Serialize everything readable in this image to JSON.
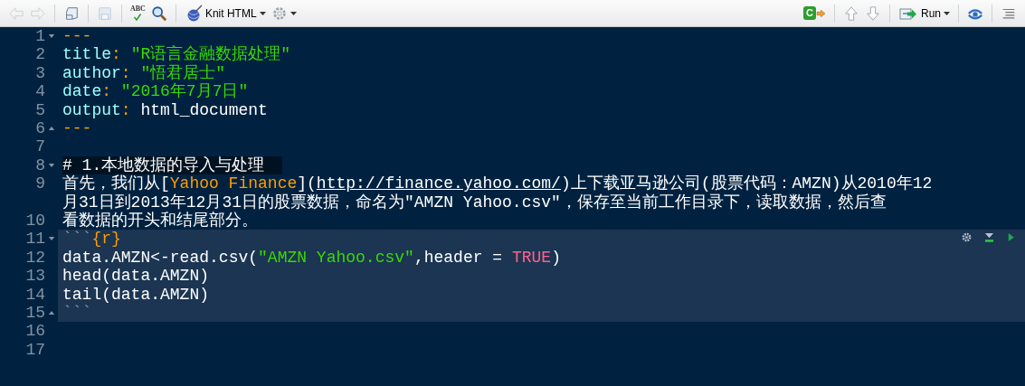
{
  "toolbar": {
    "left_groups": [
      [
        {
          "kind": "back",
          "disabled": true
        },
        {
          "kind": "forward",
          "disabled": true
        }
      ],
      [
        {
          "kind": "popout",
          "disabled": false
        }
      ],
      [
        {
          "kind": "save",
          "disabled": true
        }
      ],
      [
        {
          "kind": "spellcheck",
          "label": "ABC",
          "disabled": false
        },
        {
          "kind": "find",
          "disabled": false
        }
      ],
      [
        {
          "kind": "knit",
          "label": "Knit HTML",
          "dropdown": true,
          "disabled": false
        },
        {
          "kind": "gear",
          "dropdown": true,
          "disabled": false
        }
      ]
    ],
    "right_groups": [
      [
        {
          "kind": "source",
          "label": "C",
          "disabled": false
        }
      ],
      [
        {
          "kind": "up",
          "disabled": false
        },
        {
          "kind": "down",
          "disabled": false
        }
      ],
      [
        {
          "kind": "run",
          "label": "Run",
          "dropdown": true,
          "disabled": false
        }
      ],
      [
        {
          "kind": "rerun",
          "disabled": false
        }
      ],
      [
        {
          "kind": "outline",
          "disabled": false
        }
      ]
    ]
  },
  "editor": {
    "lines": [
      {
        "number": "1",
        "fold_start": true,
        "fold_end": false,
        "chunk": false,
        "tokens": [
          {
            "text": "---",
            "kind": "marker"
          }
        ]
      },
      {
        "number": "2",
        "fold_start": false,
        "fold_end": false,
        "chunk": false,
        "tokens": [
          {
            "text": "title",
            "kind": "key"
          },
          {
            "text": ":",
            "kind": "marker"
          },
          {
            "text": " \"R语言金融数据处理\"",
            "kind": "string"
          }
        ]
      },
      {
        "number": "3",
        "fold_start": false,
        "fold_end": false,
        "chunk": false,
        "tokens": [
          {
            "text": "author",
            "kind": "key"
          },
          {
            "text": ":",
            "kind": "marker"
          },
          {
            "text": " \"悟君居士\"",
            "kind": "string"
          }
        ]
      },
      {
        "number": "4",
        "fold_start": false,
        "fold_end": false,
        "chunk": false,
        "tokens": [
          {
            "text": "date",
            "kind": "key"
          },
          {
            "text": ":",
            "kind": "marker"
          },
          {
            "text": " \"2016年7月7日\"",
            "kind": "string"
          }
        ]
      },
      {
        "number": "5",
        "fold_start": false,
        "fold_end": false,
        "chunk": false,
        "tokens": [
          {
            "text": "output",
            "kind": "key"
          },
          {
            "text": ":",
            "kind": "marker"
          },
          {
            "text": " html_document",
            "kind": "plain"
          }
        ]
      },
      {
        "number": "6",
        "fold_start": false,
        "fold_end": true,
        "chunk": false,
        "tokens": [
          {
            "text": "---",
            "kind": "marker"
          }
        ]
      },
      {
        "number": "7",
        "fold_start": false,
        "fold_end": false,
        "chunk": false
      },
      {
        "number": "8",
        "fold_start": true,
        "fold_end": false,
        "chunk": false,
        "tokens": [
          {
            "text": "# 1.本地数据的导入与处理",
            "kind": "heading"
          }
        ]
      },
      {
        "number": "9",
        "fold_start": false,
        "fold_end": false,
        "chunk": false,
        "rows": [
          [
            {
              "text": "首先，我们从",
              "kind": "plain"
            },
            {
              "text": "[",
              "kind": "plain"
            },
            {
              "text": "Yahoo Finance",
              "kind": "link"
            },
            {
              "text": "](",
              "kind": "plain"
            },
            {
              "text": "http://finance.yahoo.com/",
              "kind": "url"
            },
            {
              "text": ")上下载亚马逊公司(股票代码：AMZN)从2010年12",
              "kind": "plain"
            }
          ],
          [
            {
              "text": "月31日到2013年12月31日的股票数据，命名为\"AMZN Yahoo.csv\"，保存至当前工作目录下，读取数据，然后查",
              "kind": "plain"
            }
          ]
        ]
      },
      {
        "number": "10",
        "fold_start": false,
        "fold_end": false,
        "chunk": false,
        "tokens": [
          {
            "text": "看数据的开头和结尾部分。",
            "kind": "plain"
          }
        ]
      },
      {
        "number": "11",
        "fold_start": true,
        "fold_end": false,
        "chunk": true,
        "tokens": [
          {
            "text": "```",
            "kind": "fence"
          },
          {
            "text": "{r}",
            "kind": "marker"
          }
        ]
      },
      {
        "number": "12",
        "fold_start": false,
        "fold_end": false,
        "chunk": true,
        "tokens": [
          {
            "text": "data.AMZN<-read.csv(",
            "kind": "plain"
          },
          {
            "text": "\"AMZN Yahoo.csv\"",
            "kind": "string"
          },
          {
            "text": ",header = ",
            "kind": "plain"
          },
          {
            "text": "TRUE",
            "kind": "bool"
          },
          {
            "text": ")",
            "kind": "plain"
          }
        ]
      },
      {
        "number": "13",
        "fold_start": false,
        "fold_end": false,
        "chunk": true,
        "tokens": [
          {
            "text": "head(data.AMZN)",
            "kind": "plain"
          }
        ]
      },
      {
        "number": "14",
        "fold_start": false,
        "fold_end": false,
        "chunk": true,
        "tokens": [
          {
            "text": "tail(data.AMZN)",
            "kind": "plain"
          }
        ]
      },
      {
        "number": "15",
        "fold_start": false,
        "fold_end": true,
        "chunk": true,
        "tokens": [
          {
            "text": "```",
            "kind": "fence"
          }
        ]
      },
      {
        "number": "16",
        "fold_start": false,
        "fold_end": false,
        "chunk": false
      },
      {
        "number": "17",
        "fold_start": false,
        "fold_end": false,
        "chunk": false
      }
    ]
  }
}
